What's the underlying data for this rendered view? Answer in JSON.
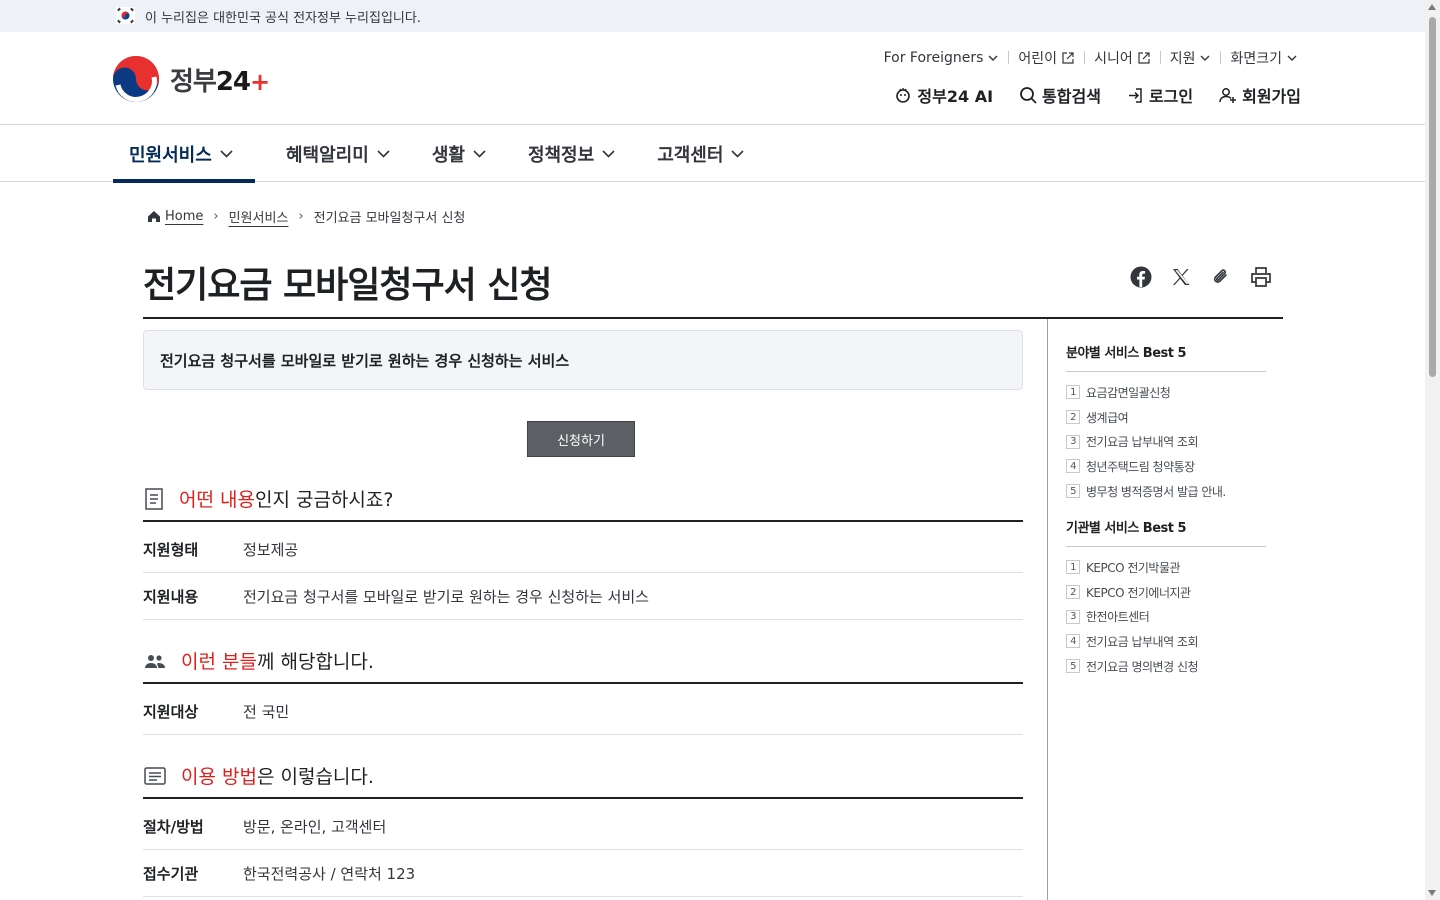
{
  "gov_banner": {
    "text": "이 누리집은 대한민국 공식 전자정부 누리집입니다."
  },
  "logo": {
    "name": "정부",
    "num": "24",
    "plus": "+"
  },
  "utility": [
    {
      "label": "For Foreigners",
      "icon": "chevron-down-icon"
    },
    {
      "label": "어린이",
      "icon": "external-link-icon"
    },
    {
      "label": "시니어",
      "icon": "external-link-icon"
    },
    {
      "label": "지원",
      "icon": "chevron-down-icon"
    },
    {
      "label": "화면크기",
      "icon": "chevron-down-icon"
    }
  ],
  "tools": [
    {
      "label": "정부24 AI",
      "icon": "ai-icon"
    },
    {
      "label": "통합검색",
      "icon": "search-icon"
    },
    {
      "label": "로그인",
      "icon": "login-icon"
    },
    {
      "label": "회원가입",
      "icon": "user-add-icon"
    }
  ],
  "nav": [
    {
      "label": "민원서비스",
      "active": true
    },
    {
      "label": "혜택알리미"
    },
    {
      "label": "생활"
    },
    {
      "label": "정책정보"
    },
    {
      "label": "고객센터"
    }
  ],
  "breadcrumb": {
    "home": "Home",
    "level1": "민원서비스",
    "current": "전기요금 모바일청구서 신청"
  },
  "page_title": "전기요금 모바일청구서 신청",
  "summary": "전기요금 청구서를 모바일로 받기로 원하는 경우 신청하는 서비스",
  "apply_button": "신청하기",
  "sections": {
    "content": {
      "hl": "어떤 내용",
      "rest": "인지 궁금하시죠?",
      "rows": [
        {
          "k": "지원형태",
          "v": "정보제공"
        },
        {
          "k": "지원내용",
          "v": "전기요금 청구서를 모바일로 받기로 원하는 경우 신청하는 서비스"
        }
      ]
    },
    "target": {
      "hl": "이런 분들",
      "rest": "께 해당합니다.",
      "rows": [
        {
          "k": "지원대상",
          "v": "전 국민"
        }
      ]
    },
    "usage": {
      "hl": "이용 방법",
      "rest": "은 이렇습니다.",
      "rows": [
        {
          "k": "절차/방법",
          "v": "방문,  온라인, 고객센터"
        },
        {
          "k": "접수기관",
          "v": "한국전력공사 / 연락처 123"
        }
      ]
    }
  },
  "sidebar": {
    "field_best": {
      "title": "분야별 서비스 Best 5",
      "items": [
        "요금감면일괄신청",
        "생계급여",
        "전기요금 납부내역 조회",
        "청년주택드림 청약통장",
        "병무청 병적증명서 발급 안내."
      ]
    },
    "org_best": {
      "title": "기관별 서비스 Best 5",
      "items": [
        "KEPCO 전기박물관",
        "KEPCO 전기에너지관",
        "한전아트센터",
        "전기요금 납부내역 조회",
        "전기요금 명의변경 신청"
      ]
    }
  },
  "colors": {
    "accent": "#052b57",
    "highlight": "#e0201c",
    "apply_button": "#5c5f63"
  }
}
